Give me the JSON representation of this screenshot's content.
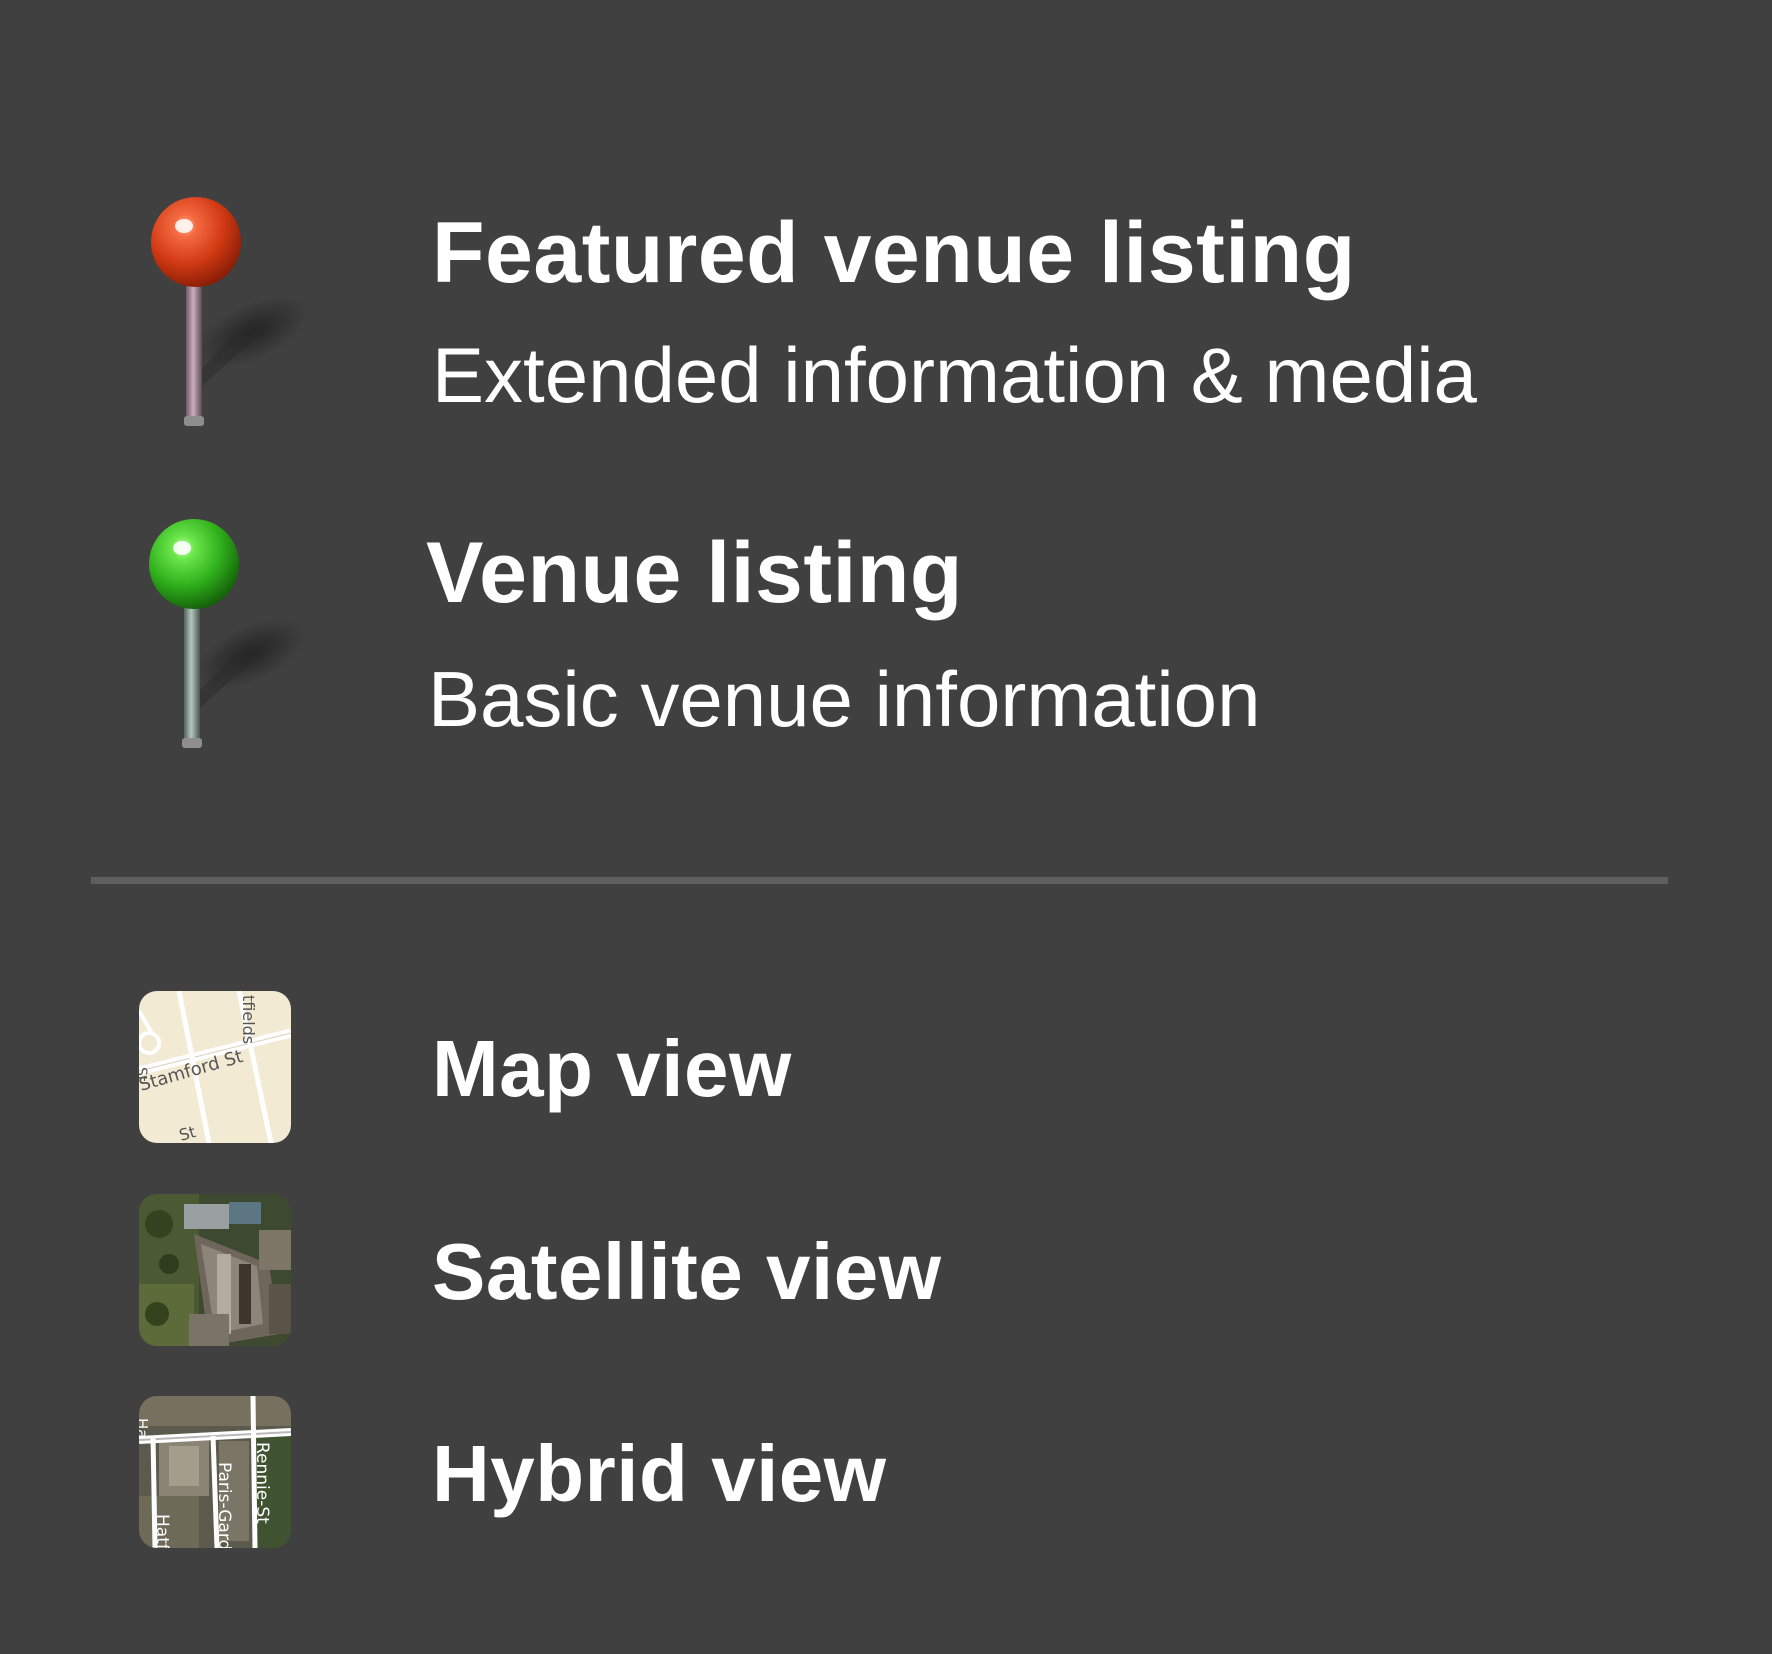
{
  "legend": {
    "featured": {
      "title": "Featured venue listing",
      "subtitle": "Extended information & media",
      "pin_color": "#d8401c",
      "icon": "red-pin-icon"
    },
    "basic": {
      "title": "Venue listing",
      "subtitle": "Basic venue information",
      "pin_color": "#3fc42a",
      "icon": "green-pin-icon"
    }
  },
  "views": {
    "map": {
      "label": "Map view",
      "icon": "map-view-icon",
      "thumb_labels": {
        "street_1": "Stamford St",
        "street_2": "tfields",
        "street_3": "St",
        "street_4": "St"
      }
    },
    "satellite": {
      "label": "Satellite view",
      "icon": "satellite-view-icon"
    },
    "hybrid": {
      "label": "Hybrid view",
      "icon": "hybrid-view-icon",
      "thumb_labels": {
        "street_1": "Rennie-St",
        "street_2": "Paris-Gard",
        "street_3": "Hatf",
        "street_4": "Ha"
      }
    }
  },
  "colors": {
    "background": "#404040",
    "divider": "#5e5e5e",
    "text": "#ffffff"
  }
}
